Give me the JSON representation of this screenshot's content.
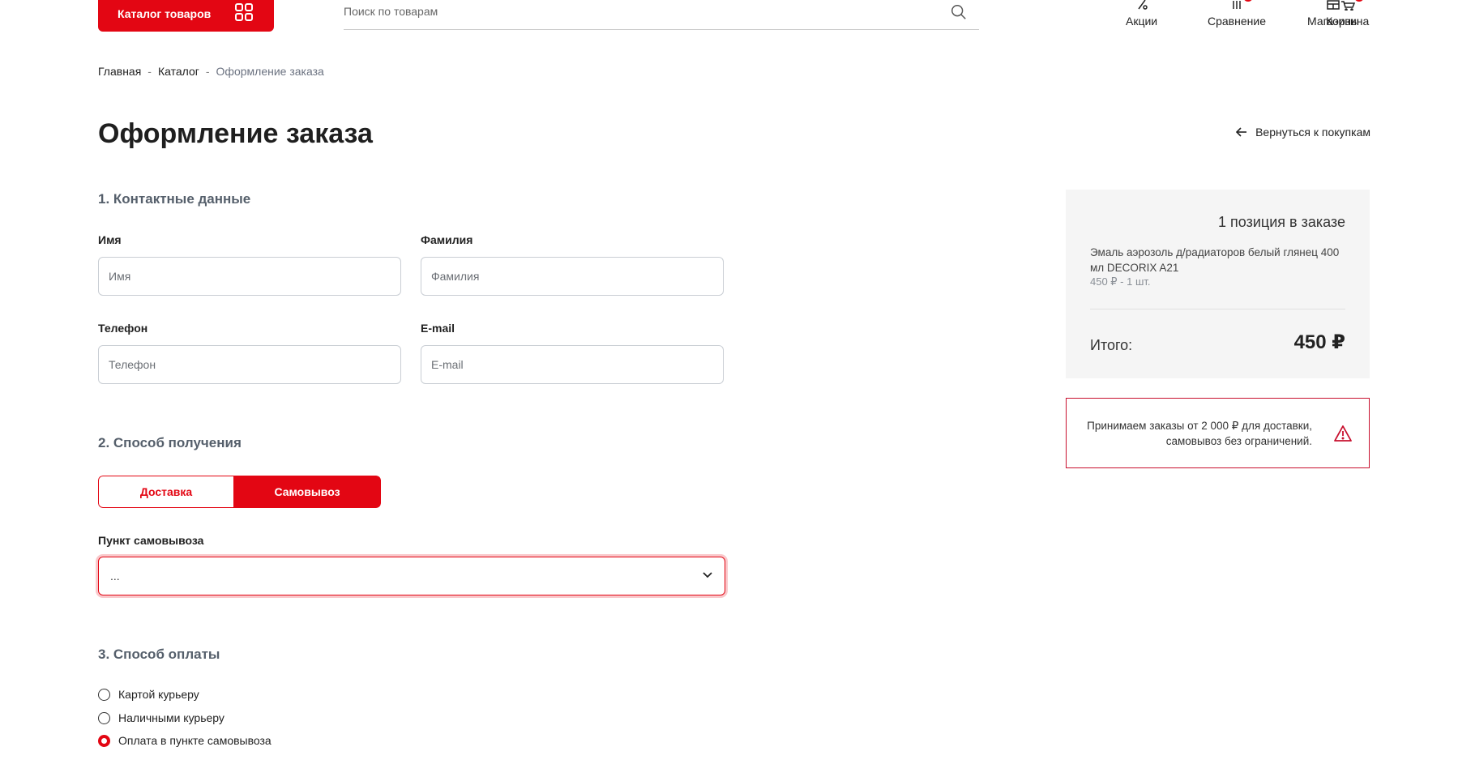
{
  "header": {
    "catalog_label": "Каталог товаров",
    "search_placeholder": "Поиск по товарам",
    "nav": [
      {
        "label": "Акции",
        "icon": "percent-icon"
      },
      {
        "label": "Сравнение",
        "icon": "compare-icon"
      },
      {
        "label": "Магазины",
        "icon": "store-icon"
      },
      {
        "label": "Корзина",
        "icon": "cart-icon"
      }
    ]
  },
  "breadcrumb": {
    "items": [
      "Главная",
      "Каталог",
      "Оформление заказа"
    ],
    "separator": "-"
  },
  "page": {
    "title": "Оформление заказа",
    "back_link": "Вернуться к покупкам"
  },
  "contact": {
    "section_title": "1. Контактные данные",
    "first_name": {
      "label": "Имя",
      "placeholder": "Имя",
      "value": ""
    },
    "last_name": {
      "label": "Фамилия",
      "placeholder": "Фамилия",
      "value": ""
    },
    "phone": {
      "label": "Телефон",
      "placeholder": "Телефон",
      "value": ""
    },
    "email": {
      "label": "E-mail",
      "placeholder": "E-mail",
      "value": ""
    }
  },
  "delivery": {
    "section_title": "2. Способ получения",
    "options": [
      "Доставка",
      "Самовывоз"
    ],
    "selected": "Самовывоз",
    "pickup_label": "Пункт самовывоза",
    "pickup_value": "..."
  },
  "payment": {
    "section_title": "3. Способ оплаты",
    "options": [
      {
        "label": "Картой курьеру",
        "checked": false
      },
      {
        "label": "Наличными курьеру",
        "checked": false
      },
      {
        "label": "Оплата в пункте самовывоза",
        "checked": true
      }
    ]
  },
  "summary": {
    "count_text": "1 позиция в заказе",
    "product_name": "Эмаль аэрозоль д/радиаторов белый глянец 400 мл DECORIX A21",
    "product_price": "450 ₽ - 1 шт.",
    "total_label": "Итого:",
    "total_value": "450 ₽"
  },
  "notice": {
    "text": "Принимаем заказы от 2 000 ₽ для доставки, самовывоз без ограничений."
  },
  "colors": {
    "accent": "#e30613",
    "summary_bg": "#f5f5f5",
    "section_title": "#555f6b"
  }
}
